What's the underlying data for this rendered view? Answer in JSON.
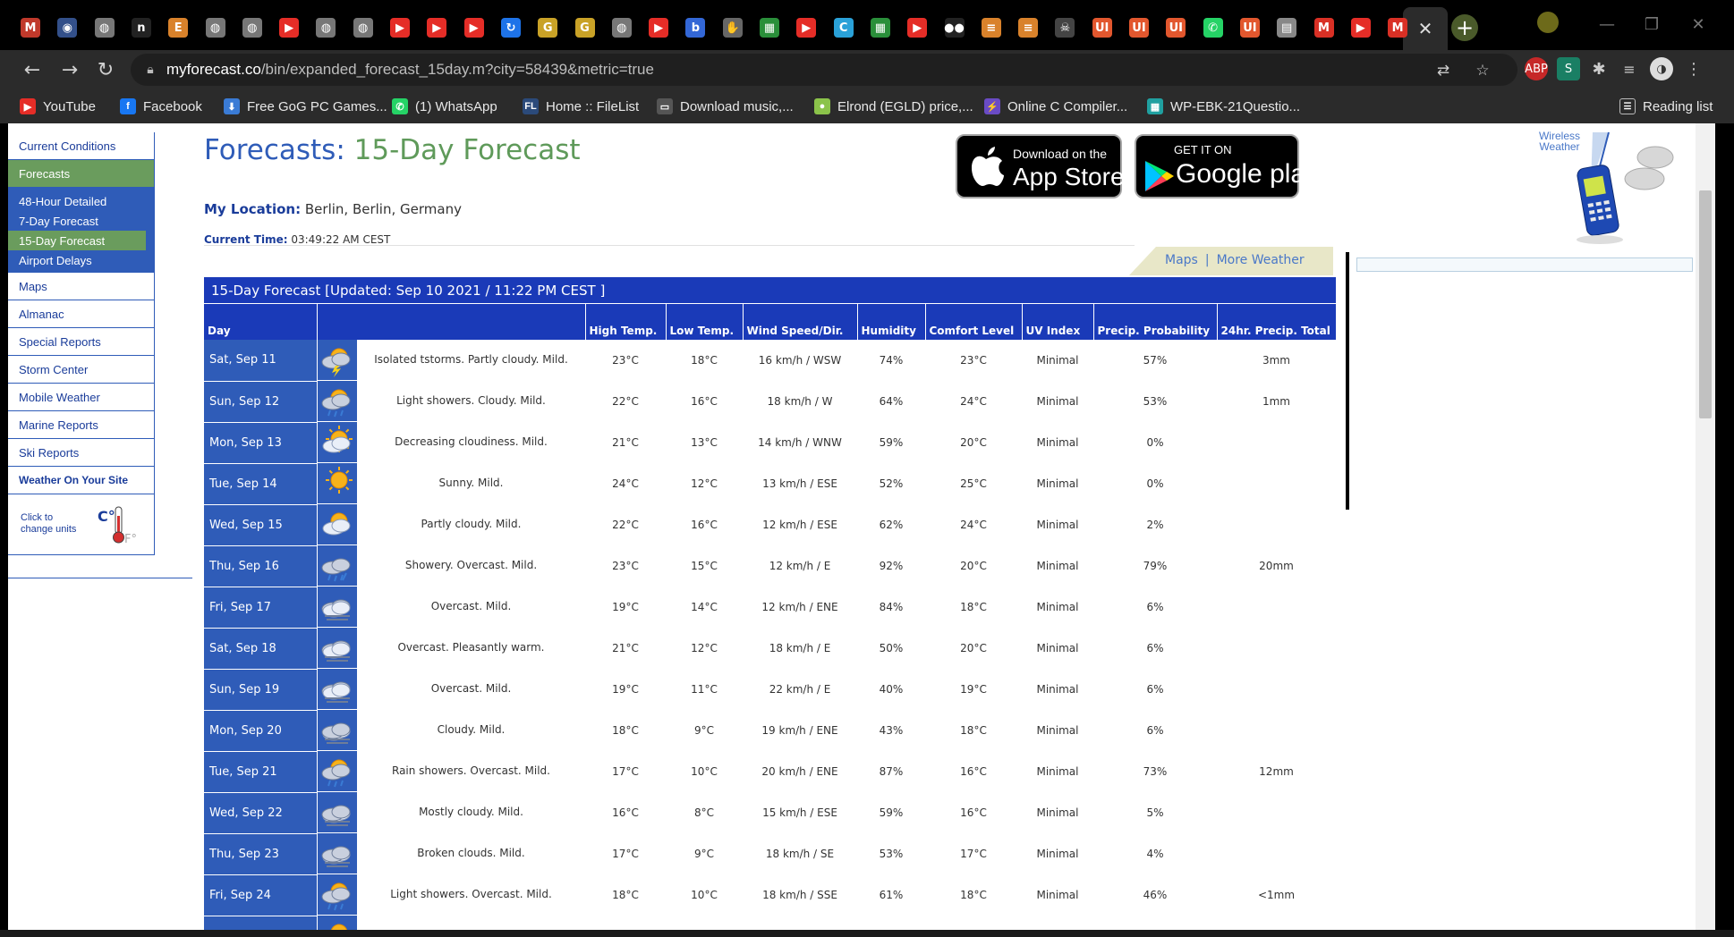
{
  "browser": {
    "tabs": [
      {
        "icon": "m-icon",
        "glyph": "M",
        "color": "#c0392b"
      },
      {
        "icon": "seal-icon",
        "glyph": "◉",
        "color": "#33508a"
      },
      {
        "icon": "globe-icon",
        "glyph": "◍",
        "color": "#777"
      },
      {
        "icon": "n-icon",
        "glyph": "n",
        "color": "#222"
      },
      {
        "icon": "e-icon",
        "glyph": "E",
        "color": "#d9822b"
      },
      {
        "icon": "globe-icon",
        "glyph": "◍",
        "color": "#777"
      },
      {
        "icon": "globe-icon",
        "glyph": "◍",
        "color": "#777"
      },
      {
        "icon": "youtube-icon",
        "glyph": "▶",
        "color": "#e52d27"
      },
      {
        "icon": "globe-icon",
        "glyph": "◍",
        "color": "#777"
      },
      {
        "icon": "globe-icon",
        "glyph": "◍",
        "color": "#777"
      },
      {
        "icon": "youtube-icon",
        "glyph": "▶",
        "color": "#e52d27"
      },
      {
        "icon": "youtube-icon",
        "glyph": "▶",
        "color": "#e52d27"
      },
      {
        "icon": "youtube-icon",
        "glyph": "▶",
        "color": "#e52d27"
      },
      {
        "icon": "sync-icon",
        "glyph": "↻",
        "color": "#1e73e8"
      },
      {
        "icon": "g-icon",
        "glyph": "G",
        "color": "#c9a227"
      },
      {
        "icon": "g-icon",
        "glyph": "G",
        "color": "#c9a227"
      },
      {
        "icon": "globe-icon",
        "glyph": "◍",
        "color": "#777"
      },
      {
        "icon": "youtube-icon",
        "glyph": "▶",
        "color": "#e52d27"
      },
      {
        "icon": "b-icon",
        "glyph": "b",
        "color": "#3367d6"
      },
      {
        "icon": "hand-icon",
        "glyph": "✋",
        "color": "#666"
      },
      {
        "icon": "windows-icon",
        "glyph": "▦",
        "color": "#2a8f3a"
      },
      {
        "icon": "youtube-icon",
        "glyph": "▶",
        "color": "#e52d27"
      },
      {
        "icon": "c-icon",
        "glyph": "C",
        "color": "#2aa1d8"
      },
      {
        "icon": "windows-icon",
        "glyph": "▦",
        "color": "#2a8f3a"
      },
      {
        "icon": "youtube-icon",
        "glyph": "▶",
        "color": "#e52d27"
      },
      {
        "icon": "medium-icon",
        "glyph": "●●",
        "color": "#222"
      },
      {
        "icon": "stack-icon",
        "glyph": "≡",
        "color": "#d9822b"
      },
      {
        "icon": "stack-icon",
        "glyph": "≡",
        "color": "#d9822b"
      },
      {
        "icon": "pirate-icon",
        "glyph": "☠",
        "color": "#444"
      },
      {
        "icon": "ui-icon",
        "glyph": "UI",
        "color": "#e2572e"
      },
      {
        "icon": "ui-icon",
        "glyph": "UI",
        "color": "#e2572e"
      },
      {
        "icon": "ui-icon",
        "glyph": "UI",
        "color": "#e2572e"
      },
      {
        "icon": "whatsapp-icon",
        "glyph": "✆",
        "color": "#25d366"
      },
      {
        "icon": "ui-icon",
        "glyph": "UI",
        "color": "#e2572e"
      },
      {
        "icon": "doc-icon",
        "glyph": "▤",
        "color": "#888"
      },
      {
        "icon": "gmail-icon",
        "glyph": "M",
        "color": "#d93025"
      },
      {
        "icon": "youtube-icon",
        "glyph": "▶",
        "color": "#e52d27"
      },
      {
        "icon": "gmail-icon",
        "glyph": "M",
        "color": "#d93025"
      }
    ],
    "active_tab_glyph": "✕",
    "new_tab_glyph": "+",
    "url_host": "myforecast.co",
    "url_path": "/bin/expanded_forecast_15day.m?city=58439&metric=true",
    "bookmarks": [
      {
        "label": "YouTube",
        "icon": "youtube-icon",
        "glyph": "▶",
        "color": "#e52d27"
      },
      {
        "label": "Facebook",
        "icon": "facebook-icon",
        "glyph": "f",
        "color": "#1877f2"
      },
      {
        "label": "Free GoG PC Games...",
        "icon": "download-icon",
        "glyph": "⬇",
        "color": "#3a7bd5"
      },
      {
        "label": "(1) WhatsApp",
        "icon": "whatsapp-icon",
        "glyph": "✆",
        "color": "#25d366"
      },
      {
        "label": "Home :: FileList",
        "icon": "filelist-icon",
        "glyph": "FL",
        "color": "#2b4a7a"
      },
      {
        "label": "Download music,...",
        "icon": "monitor-icon",
        "glyph": "▭",
        "color": "#555"
      },
      {
        "label": "Elrond (EGLD) price,...",
        "icon": "coin-icon",
        "glyph": "●",
        "color": "#8bc34a"
      },
      {
        "label": "Online C Compiler...",
        "icon": "bolt-icon",
        "glyph": "⚡",
        "color": "#6a4bc4"
      },
      {
        "label": "WP-EBK-21Questio...",
        "icon": "grid-icon",
        "glyph": "▦",
        "color": "#20a0a0"
      }
    ],
    "reading_list": "Reading list"
  },
  "sidebar": {
    "items_top": [
      "Current Conditions",
      "Forecasts"
    ],
    "sub_items": [
      "48-Hour Detailed",
      "7-Day Forecast",
      "15-Day Forecast",
      "Airport Delays"
    ],
    "items_bottom": [
      "Maps",
      "Almanac",
      "Special Reports",
      "Storm Center",
      "Mobile Weather",
      "Marine Reports",
      "Ski Reports",
      "Weather On Your Site"
    ],
    "units_text_1": "Click to",
    "units_text_2": "change units"
  },
  "header": {
    "title_prefix": "Forecasts:",
    "title_main": "15-Day Forecast",
    "location_label": "My Location:",
    "location_value": "Berlin, Berlin, Germany",
    "time_label": "Current Time:",
    "time_value": "03:49:22 AM CEST",
    "appstore_small": "Download on the",
    "appstore_big": "App Store",
    "googleplay_small": "GET IT ON",
    "googleplay_big": "Google play",
    "wireless_label": "Wireless Weather",
    "maps_link": "Maps",
    "more_link": "More Weather"
  },
  "forecast": {
    "title": "15-Day Forecast  [Updated: Sep 10 2021 / 11:22 PM CEST ]",
    "columns": [
      "Day",
      "",
      "High Temp.",
      "Low Temp.",
      "Wind Speed/Dir.",
      "Humidity",
      "Comfort Level",
      "UV Index",
      "Precip. Probability",
      "24hr. Precip. Total"
    ],
    "rows": [
      {
        "day": "Sat, Sep 11",
        "icon": "tstorm-icon",
        "cond": "Isolated tstorms. Partly cloudy. Mild.",
        "high": "23°C",
        "low": "18°C",
        "wind": "16 km/h / WSW",
        "hum": "74%",
        "comfort": "23°C",
        "uv": "Minimal",
        "prob": "57%",
        "total": "3mm"
      },
      {
        "day": "Sun, Sep 12",
        "icon": "shower-icon",
        "cond": "Light showers. Cloudy. Mild.",
        "high": "22°C",
        "low": "16°C",
        "wind": "18 km/h / W",
        "hum": "64%",
        "comfort": "24°C",
        "uv": "Minimal",
        "prob": "53%",
        "total": "1mm"
      },
      {
        "day": "Mon, Sep 13",
        "icon": "partly-sunny-icon",
        "cond": "Decreasing cloudiness. Mild.",
        "high": "21°C",
        "low": "13°C",
        "wind": "14 km/h / WNW",
        "hum": "59%",
        "comfort": "20°C",
        "uv": "Minimal",
        "prob": "0%",
        "total": ""
      },
      {
        "day": "Tue, Sep 14",
        "icon": "sunny-icon",
        "cond": "Sunny. Mild.",
        "high": "24°C",
        "low": "12°C",
        "wind": "13 km/h / ESE",
        "hum": "52%",
        "comfort": "25°C",
        "uv": "Minimal",
        "prob": "0%",
        "total": ""
      },
      {
        "day": "Wed, Sep 15",
        "icon": "partly-cloudy-icon",
        "cond": "Partly cloudy. Mild.",
        "high": "22°C",
        "low": "16°C",
        "wind": "12 km/h / ESE",
        "hum": "62%",
        "comfort": "24°C",
        "uv": "Minimal",
        "prob": "2%",
        "total": ""
      },
      {
        "day": "Thu, Sep 16",
        "icon": "rain-icon",
        "cond": "Showery. Overcast. Mild.",
        "high": "23°C",
        "low": "15°C",
        "wind": "12 km/h / E",
        "hum": "92%",
        "comfort": "20°C",
        "uv": "Minimal",
        "prob": "79%",
        "total": "20mm"
      },
      {
        "day": "Fri, Sep 17",
        "icon": "overcast-icon",
        "cond": "Overcast. Mild.",
        "high": "19°C",
        "low": "14°C",
        "wind": "12 km/h / ENE",
        "hum": "84%",
        "comfort": "18°C",
        "uv": "Minimal",
        "prob": "6%",
        "total": ""
      },
      {
        "day": "Sat, Sep 18",
        "icon": "overcast-icon",
        "cond": "Overcast. Pleasantly warm.",
        "high": "21°C",
        "low": "12°C",
        "wind": "18 km/h / E",
        "hum": "50%",
        "comfort": "20°C",
        "uv": "Minimal",
        "prob": "6%",
        "total": ""
      },
      {
        "day": "Sun, Sep 19",
        "icon": "overcast-icon",
        "cond": "Overcast. Mild.",
        "high": "19°C",
        "low": "11°C",
        "wind": "22 km/h / E",
        "hum": "40%",
        "comfort": "19°C",
        "uv": "Minimal",
        "prob": "6%",
        "total": ""
      },
      {
        "day": "Mon, Sep 20",
        "icon": "cloudy-icon",
        "cond": "Cloudy. Mild.",
        "high": "18°C",
        "low": "9°C",
        "wind": "19 km/h / ENE",
        "hum": "43%",
        "comfort": "18°C",
        "uv": "Minimal",
        "prob": "6%",
        "total": ""
      },
      {
        "day": "Tue, Sep 21",
        "icon": "shower-icon",
        "cond": "Rain showers. Overcast. Mild.",
        "high": "17°C",
        "low": "10°C",
        "wind": "20 km/h / ENE",
        "hum": "87%",
        "comfort": "16°C",
        "uv": "Minimal",
        "prob": "73%",
        "total": "12mm"
      },
      {
        "day": "Wed, Sep 22",
        "icon": "cloudy-icon",
        "cond": "Mostly cloudy. Mild.",
        "high": "16°C",
        "low": "8°C",
        "wind": "15 km/h / ESE",
        "hum": "59%",
        "comfort": "16°C",
        "uv": "Minimal",
        "prob": "5%",
        "total": ""
      },
      {
        "day": "Thu, Sep 23",
        "icon": "cloudy-icon",
        "cond": "Broken clouds. Mild.",
        "high": "17°C",
        "low": "9°C",
        "wind": "18 km/h / SE",
        "hum": "53%",
        "comfort": "17°C",
        "uv": "Minimal",
        "prob": "4%",
        "total": ""
      },
      {
        "day": "Fri, Sep 24",
        "icon": "shower-icon",
        "cond": "Light showers. Overcast. Mild.",
        "high": "18°C",
        "low": "10°C",
        "wind": "18 km/h / SSE",
        "hum": "61%",
        "comfort": "18°C",
        "uv": "Minimal",
        "prob": "46%",
        "total": "<1mm"
      },
      {
        "day": "",
        "icon": "partly-cloudy-icon",
        "cond": "",
        "high": "",
        "low": "",
        "wind": "",
        "hum": "",
        "comfort": "",
        "uv": "",
        "prob": "",
        "total": ""
      }
    ]
  }
}
